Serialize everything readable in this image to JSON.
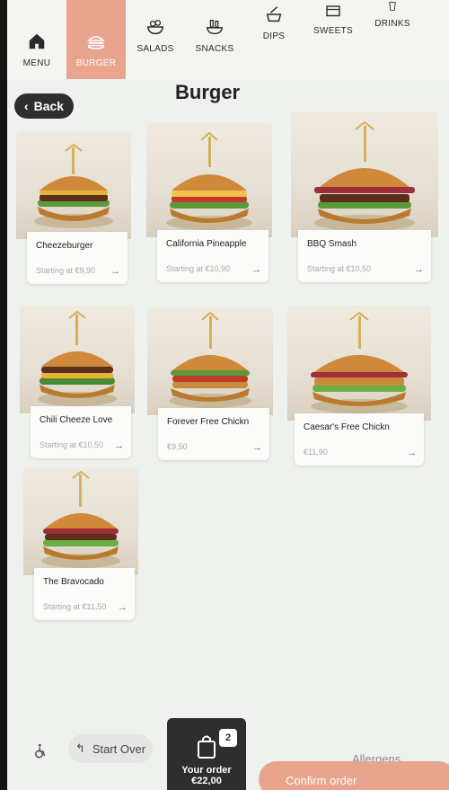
{
  "nav": {
    "items": [
      {
        "label": "MENU",
        "icon": "home-icon"
      },
      {
        "label": "BURGER",
        "icon": "burger-icon"
      },
      {
        "label": "SALADS",
        "icon": "salad-icon"
      },
      {
        "label": "SNACKS",
        "icon": "snacks-icon"
      },
      {
        "label": "DIPS",
        "icon": "dip-icon"
      },
      {
        "label": "SWEETS",
        "icon": "sweets-icon"
      },
      {
        "label": "DRINKS",
        "icon": "drink-icon"
      }
    ],
    "active": "BURGER"
  },
  "header": {
    "back_label": "Back",
    "title": "Burger"
  },
  "products": [
    {
      "name": "Cheezeburger",
      "price": "Starting at €9,90"
    },
    {
      "name": "California Pineapple",
      "price": "Starting at €10,90"
    },
    {
      "name": "BBQ Smash",
      "price": "Starting at €10,50"
    },
    {
      "name": "Chili Cheeze Love",
      "price": "Starting at €10,50"
    },
    {
      "name": "Forever Free Chickn",
      "price": "€9,50"
    },
    {
      "name": "Caesar's Free Chickn",
      "price": "€11,90"
    },
    {
      "name": "The Bravocado",
      "price": "Starting at €11,50"
    }
  ],
  "footer": {
    "start_over_label": "Start Over",
    "order_label": "Your order",
    "order_total": "€22,00",
    "order_count": "2",
    "allergens_label": "Allergens",
    "confirm_label": "Confirm order"
  },
  "colors": {
    "accent": "#e9a48e",
    "dark": "#2e2e2e",
    "background": "#eef1ee"
  }
}
